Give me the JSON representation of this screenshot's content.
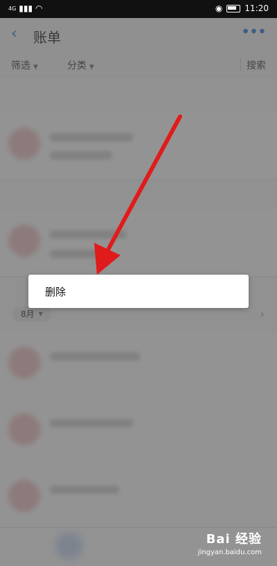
{
  "status_bar": {
    "network": "4G",
    "time": "11:20"
  },
  "header": {
    "back_icon": "back-chevron-icon",
    "title": "账单",
    "more_icon": "more-dots-icon"
  },
  "filters": {
    "filter_label": "筛选",
    "category_label": "分类",
    "search_label": "搜索"
  },
  "list": {
    "month_label": "8月"
  },
  "context_menu": {
    "delete_label": "删除"
  },
  "watermark": {
    "brand": "Bai 经验",
    "url": "jingyan.baidu.com"
  },
  "colors": {
    "accent": "#1f6fd6",
    "arrow": "#e01b1b",
    "overlay": "#505050"
  }
}
